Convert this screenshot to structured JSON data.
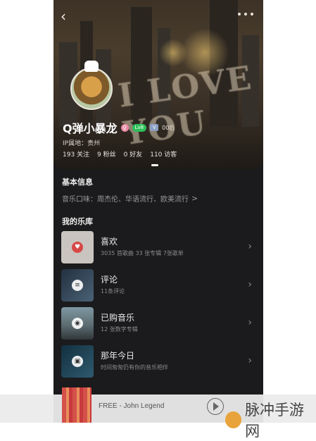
{
  "hero": {
    "bg_text": "I LOVE YOU",
    "username": "Q弹小暴龙",
    "gender_symbol": "♀",
    "level_badge": "Lv8",
    "vip_badge": "V",
    "age_tag": "00后",
    "ip_location": "IP属地：贵州",
    "stats": [
      {
        "label": "193 关注"
      },
      {
        "label": "9 粉丝"
      },
      {
        "label": "0 好友"
      },
      {
        "label": "110 访客"
      }
    ]
  },
  "basic_info": {
    "title": "基本信息",
    "music_taste": "音乐口味：周杰伦、华语流行、欧美流行",
    "chevron": ">"
  },
  "library": {
    "title": "我的乐库",
    "items": [
      {
        "title": "喜欢",
        "subtitle": "3035 首歌曲 33 张专辑 7张歌单",
        "icon": "heart-icon",
        "color": "#c9c4bf"
      },
      {
        "title": "评论",
        "subtitle": "11条评论",
        "icon": "comment-icon",
        "color": "#2a3a4a"
      },
      {
        "title": "已购音乐",
        "subtitle": "12 张数字专辑",
        "icon": "disc-icon",
        "color": "#6a7d86"
      },
      {
        "title": "那年今日",
        "subtitle": "时间匆匆仍有你的音乐相伴",
        "icon": "calendar-icon",
        "color": "#1f3a4a"
      }
    ]
  },
  "player": {
    "track": "FREE - John Legend"
  },
  "watermark": {
    "text": "脉冲手游网"
  }
}
